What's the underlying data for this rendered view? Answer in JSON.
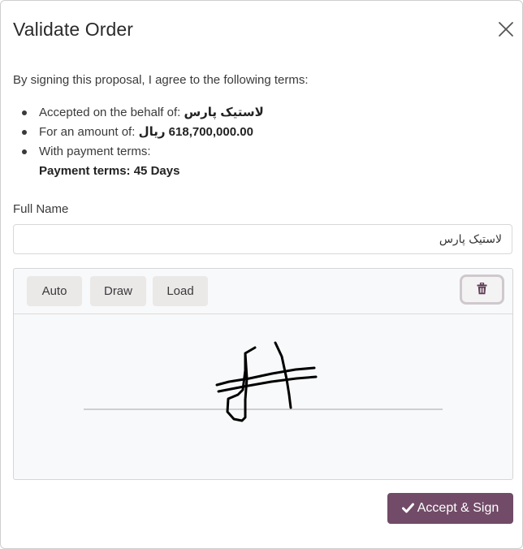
{
  "modal": {
    "title": "Validate Order",
    "close_icon": "close-icon"
  },
  "intro_text": "By signing this proposal, I agree to the following terms:",
  "terms": {
    "accepted_prefix": "Accepted on the behalf of: ",
    "accepted_value": "لاستیک پارس",
    "amount_prefix": "For an amount of: ",
    "amount_value": "618,700,000.00 ریال",
    "payment_prefix": "With payment terms:",
    "payment_value": "Payment terms: 45 Days"
  },
  "full_name": {
    "label": "Full Name",
    "value": "لاستیک پارس"
  },
  "signature": {
    "modes": [
      "Auto",
      "Draw",
      "Load"
    ],
    "clear_icon": "trash-icon"
  },
  "accept_button": {
    "label": "Accept & Sign",
    "icon": "check-icon",
    "color": "#714b67"
  }
}
